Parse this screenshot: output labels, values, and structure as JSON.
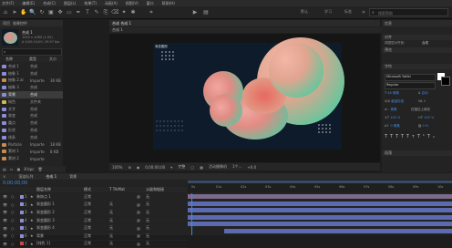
{
  "menu": [
    "文件(F)",
    "编辑(E)",
    "合成(C)",
    "图层(L)",
    "效果(T)",
    "动画(A)",
    "视图(V)",
    "窗口",
    "帮助(H)"
  ],
  "workspaces": [
    "默认",
    "学习",
    "标准",
    "小屏幕"
  ],
  "project": {
    "tab_project": "项目",
    "tab_effects": "效果控件",
    "comp_name": "合成 1",
    "comp_info": "1920 x 1080 (1.00)",
    "comp_info2": "Δ 0;00;10;00, 29.97 fps",
    "header_name": "名称",
    "header_type": "类型",
    "header_size": "大小",
    "items": [
      {
        "name": "合成 1",
        "type": "合成",
        "size": "",
        "color": "#8d8dd6"
      },
      {
        "name": "抽象 1",
        "type": "合成",
        "size": "",
        "color": "#8d8dd6"
      },
      {
        "name": "抽象 2.ai",
        "type": "Importe",
        "size": "36 KB",
        "color": "#c98b4e"
      },
      {
        "name": "抽象 3",
        "type": "合成",
        "size": "",
        "color": "#8d8dd6"
      },
      {
        "name": "背景",
        "type": "合成",
        "size": "",
        "color": "#8d8dd6"
      },
      {
        "name": "纯色",
        "type": "文件夹",
        "size": "",
        "color": "#d1b64c"
      },
      {
        "name": "文字",
        "type": "合成",
        "size": "",
        "color": "#8d8dd6"
      },
      {
        "name": "渐变",
        "type": "合成",
        "size": "",
        "color": "#8d8dd6"
      },
      {
        "name": "圆点",
        "type": "合成",
        "size": "",
        "color": "#8d8dd6"
      },
      {
        "name": "形状",
        "type": "合成",
        "size": "",
        "color": "#8d8dd6"
      },
      {
        "name": "线条",
        "type": "合成",
        "size": "",
        "color": "#8d8dd6"
      },
      {
        "name": "Particle",
        "type": "Importe",
        "size": "18 KB",
        "color": "#c98b4e"
      },
      {
        "name": "素材 1",
        "type": "Importe",
        "size": "8 KB",
        "color": "#c98b4e"
      },
      {
        "name": "素材 2",
        "type": "Importe",
        "size": "",
        "color": "#c98b4e"
      }
    ],
    "footer": "8 bpc"
  },
  "viewer": {
    "tab_label": "合成 合成 1",
    "sub_label": "合成 1",
    "layer_label": "渐变圆形",
    "zoom": "100%",
    "time": "0;00;00;00",
    "resolution": "完整",
    "camera": "活动摄像机",
    "views": "1个...",
    "offset": "+0.0"
  },
  "right_panel": {
    "search_placeholder": "搜索帮助",
    "info_tab": "信息",
    "align_tab": "对齐",
    "align_label": "将图层对齐到：",
    "align_target": "合成",
    "preview_tab": "预览",
    "character_tab": "字符",
    "font_name": "Microsoft YaHei",
    "font_style": "Regular",
    "font_size": "48 像素",
    "leading": "自动",
    "kerning": "度量标准",
    "tracking": "0",
    "stroke": "- 像素",
    "stroke_mode": "在描边上填充",
    "vscale": "100 %",
    "hscale": "100 %",
    "baseline": "0 像素",
    "tsume": "0 %",
    "paragraph_tab": "段落"
  },
  "timeline": {
    "tab_render": "渲染队列",
    "tab_comp": "合成 1",
    "tab_other": "背景",
    "timecode": "0;00;00;00",
    "frame_info": "00000 (29.97 fps)",
    "col_name": "图层名称",
    "col_mode": "模式",
    "col_trkmat": "T TrkMat",
    "col_parent": "父级和链接",
    "rows": [
      {
        "num": "1",
        "name": "装饰点 1",
        "mode": "正常",
        "trk": "",
        "parent": "无",
        "color": "#8d8dd6"
      },
      {
        "num": "2",
        "name": "渐变圆形 1",
        "mode": "正常",
        "trk": "无",
        "parent": "无",
        "color": "#8d8dd6"
      },
      {
        "num": "3",
        "name": "渐变圆形 2",
        "mode": "正常",
        "trk": "无",
        "parent": "无",
        "color": "#8d8dd6"
      },
      {
        "num": "4",
        "name": "渐变圆形 3",
        "mode": "正常",
        "trk": "无",
        "parent": "无",
        "color": "#8d8dd6"
      },
      {
        "num": "5",
        "name": "渐变圆形 4",
        "mode": "正常",
        "trk": "无",
        "parent": "无",
        "color": "#8d8dd6"
      },
      {
        "num": "6",
        "name": "背景",
        "mode": "正常",
        "trk": "无",
        "parent": "无",
        "color": "#8d8dd6"
      },
      {
        "num": "7",
        "name": "[纯色 1]",
        "mode": "正常",
        "trk": "无",
        "parent": "无",
        "color": "#c24d4d"
      }
    ],
    "ruler": [
      "0s",
      "01s",
      "02s",
      "03s",
      "04s",
      "05s",
      "06s",
      "07s",
      "08s",
      "09s",
      "10s"
    ],
    "footer": "切换开关/模式"
  }
}
